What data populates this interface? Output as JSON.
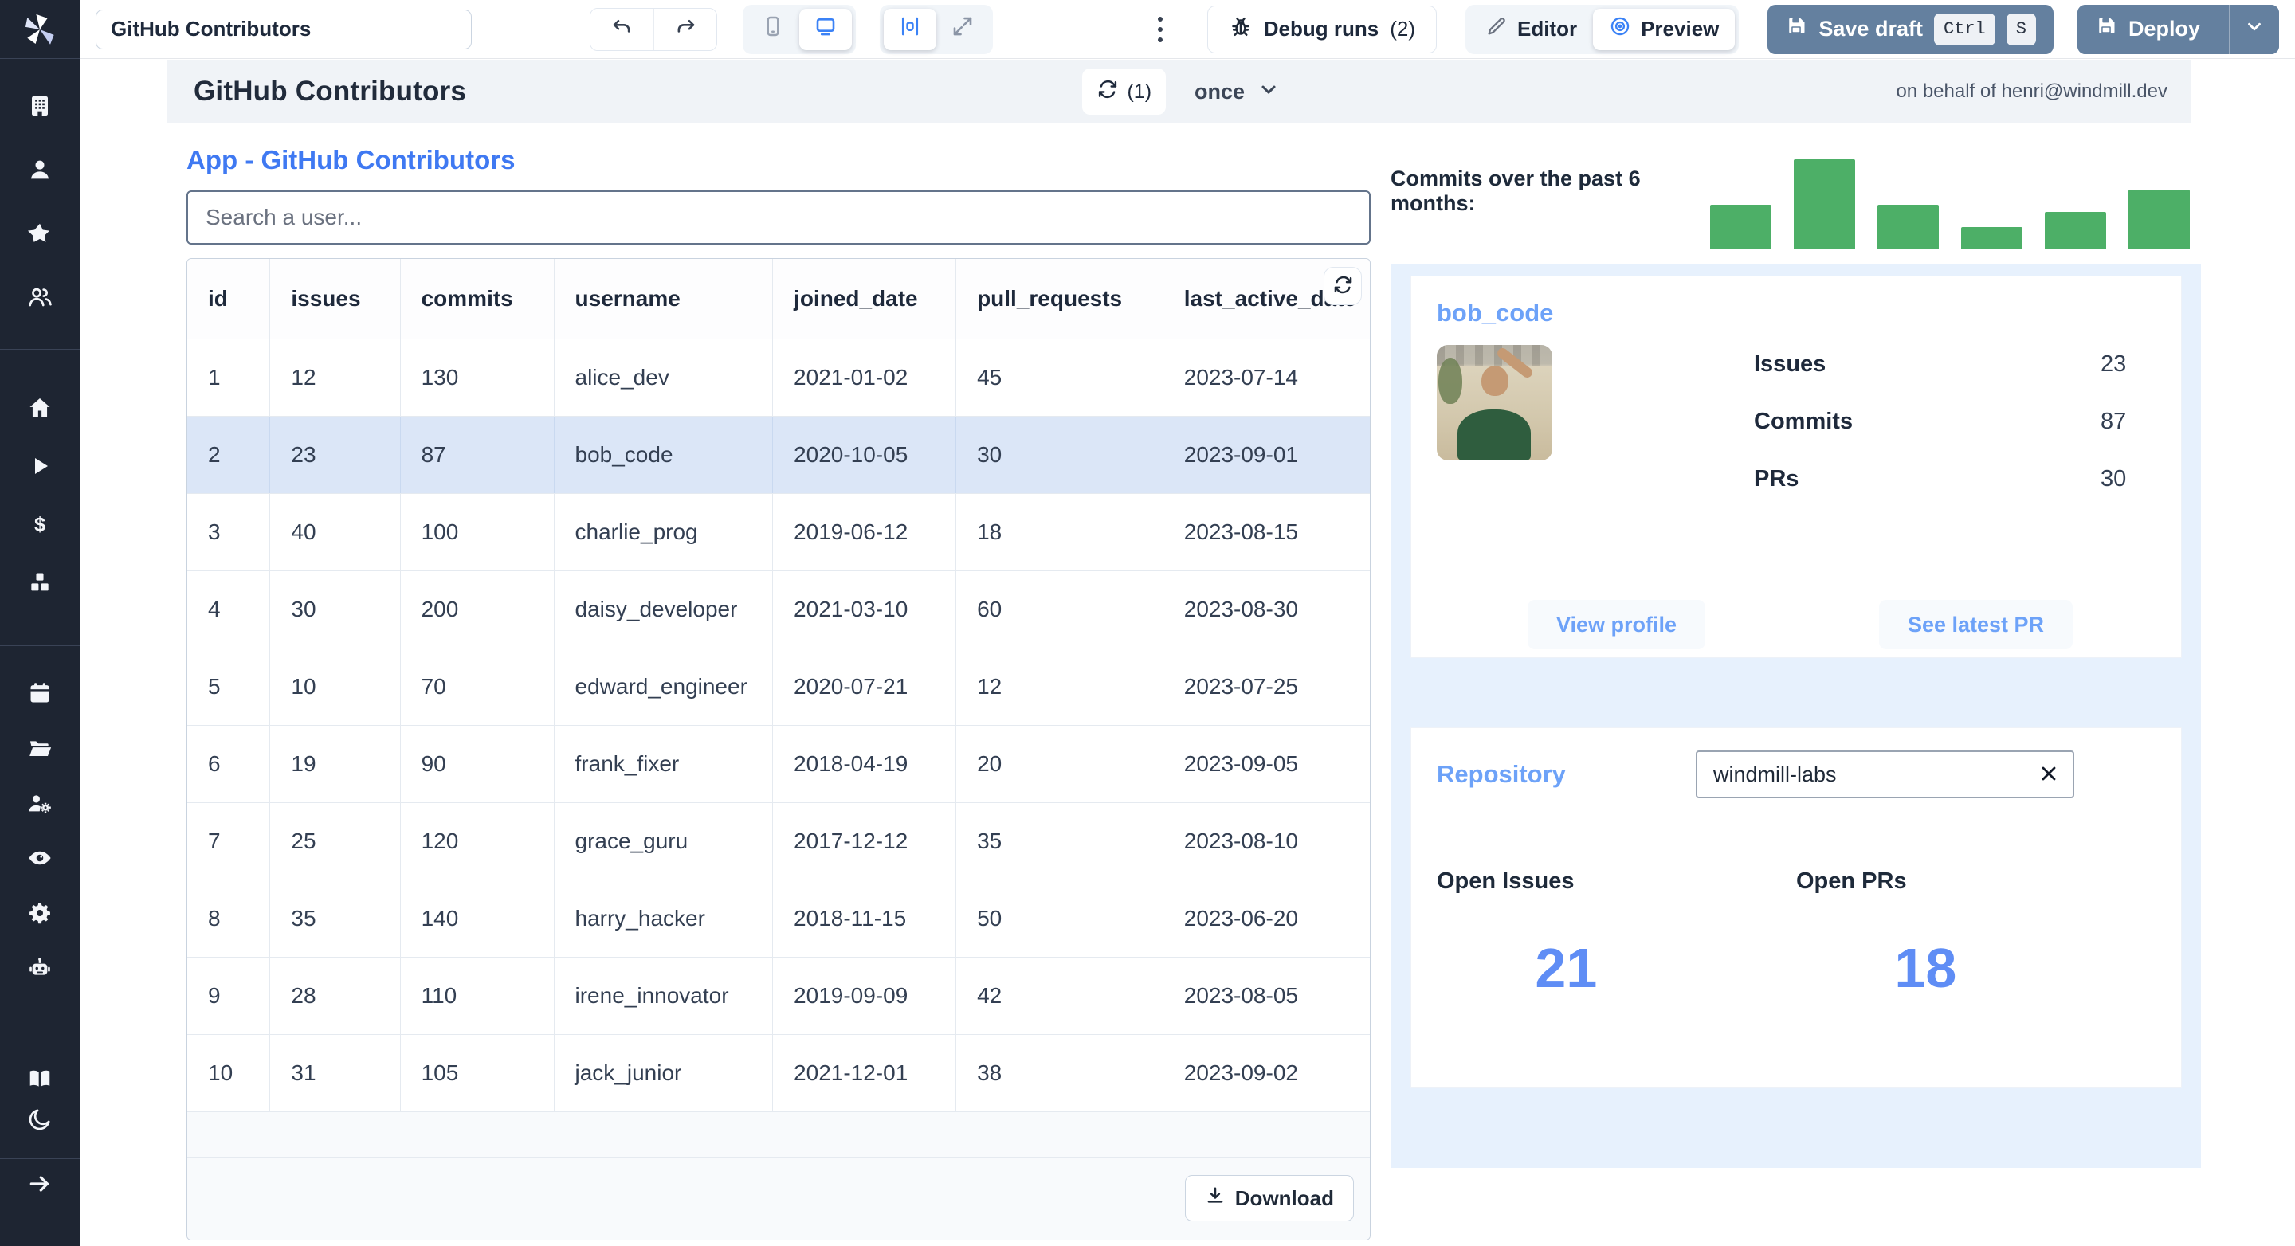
{
  "colors": {
    "sidebar_bg": "#1e2532",
    "accent_blue": "#3f79f2",
    "card_title_blue": "#6da2f8",
    "big_number_blue": "#5f8df5",
    "bar_green": "#4daf67",
    "slate_button": "#64809f",
    "selected_row": "#dbe6f7",
    "panel_bg": "#e7f1fd",
    "header_bar_bg": "#f0f3f7"
  },
  "sidebar": {
    "logo": "windmill-logo",
    "groups": [
      [
        "building",
        "user",
        "star",
        "users"
      ],
      [
        "home",
        "play",
        "dollar",
        "cubes"
      ],
      [
        "calendar",
        "folder",
        "user-cog",
        "eye",
        "gear",
        "bot"
      ],
      [
        "book",
        "moon"
      ],
      [
        "arrow-right"
      ]
    ]
  },
  "toolbar": {
    "app_title_input": "GitHub Contributors",
    "undo_icon": "undo",
    "redo_icon": "redo",
    "device_toggle": {
      "options": [
        "mobile",
        "desktop"
      ],
      "selected": "desktop"
    },
    "layout_toggle": {
      "options": [
        "align-center",
        "expand"
      ],
      "selected": "align-center"
    },
    "debug_runs_label": "Debug runs",
    "debug_runs_count": "(2)",
    "editor_label": "Editor",
    "preview_label": "Preview",
    "mode_selected": "Preview",
    "save_draft_label": "Save draft",
    "save_shortcut_keys": [
      "Ctrl",
      "S"
    ],
    "deploy_label": "Deploy"
  },
  "app_header": {
    "title": "GitHub Contributors",
    "refresh_count": "(1)",
    "schedule_label": "once",
    "on_behalf_of": "on behalf of henri@windmill.dev"
  },
  "main": {
    "heading": "App - GitHub Contributors",
    "search_placeholder": "Search a user...",
    "table": {
      "columns": [
        "id",
        "issues",
        "commits",
        "username",
        "joined_date",
        "pull_requests",
        "last_active_date"
      ],
      "column_widths_pct": [
        7,
        11,
        13,
        18.5,
        15.5,
        17.5,
        17.5
      ],
      "selected_row_index": 1,
      "rows": [
        [
          "1",
          "12",
          "130",
          "alice_dev",
          "2021-01-02",
          "45",
          "2023-07-14"
        ],
        [
          "2",
          "23",
          "87",
          "bob_code",
          "2020-10-05",
          "30",
          "2023-09-01"
        ],
        [
          "3",
          "40",
          "100",
          "charlie_prog",
          "2019-06-12",
          "18",
          "2023-08-15"
        ],
        [
          "4",
          "30",
          "200",
          "daisy_developer",
          "2021-03-10",
          "60",
          "2023-08-30"
        ],
        [
          "5",
          "10",
          "70",
          "edward_engineer",
          "2020-07-21",
          "12",
          "2023-07-25"
        ],
        [
          "6",
          "19",
          "90",
          "frank_fixer",
          "2018-04-19",
          "20",
          "2023-09-05"
        ],
        [
          "7",
          "25",
          "120",
          "grace_guru",
          "2017-12-12",
          "35",
          "2023-08-10"
        ],
        [
          "8",
          "35",
          "140",
          "harry_hacker",
          "2018-11-15",
          "50",
          "2023-06-20"
        ],
        [
          "9",
          "28",
          "110",
          "irene_innovator",
          "2019-09-09",
          "42",
          "2023-08-05"
        ],
        [
          "10",
          "31",
          "105",
          "jack_junior",
          "2021-12-01",
          "38",
          "2023-09-02"
        ]
      ],
      "download_label": "Download"
    }
  },
  "right_panel": {
    "chart_label": "Commits over the past 6 months:",
    "user_card": {
      "title": "bob_code",
      "avatar": "photo-of-bob",
      "stats": [
        {
          "label": "Issues",
          "value": "23"
        },
        {
          "label": "Commits",
          "value": "87"
        },
        {
          "label": "PRs",
          "value": "30"
        }
      ],
      "view_profile_label": "View profile",
      "see_latest_pr_label": "See latest PR"
    },
    "repo_card": {
      "title": "Repository",
      "input_value": "windmill-labs",
      "metrics": [
        {
          "label": "Open Issues",
          "value": "21"
        },
        {
          "label": "Open PRs",
          "value": "18"
        }
      ]
    }
  },
  "chart_data": {
    "type": "bar",
    "title": "Commits over the past 6 months:",
    "categories": [
      "",
      "",
      "",
      "",
      "",
      ""
    ],
    "values": [
      50,
      100,
      50,
      25,
      42,
      66
    ],
    "unit": "relative height (no axis shown)",
    "color": "#4daf67",
    "grid": "off",
    "legend": "none"
  }
}
